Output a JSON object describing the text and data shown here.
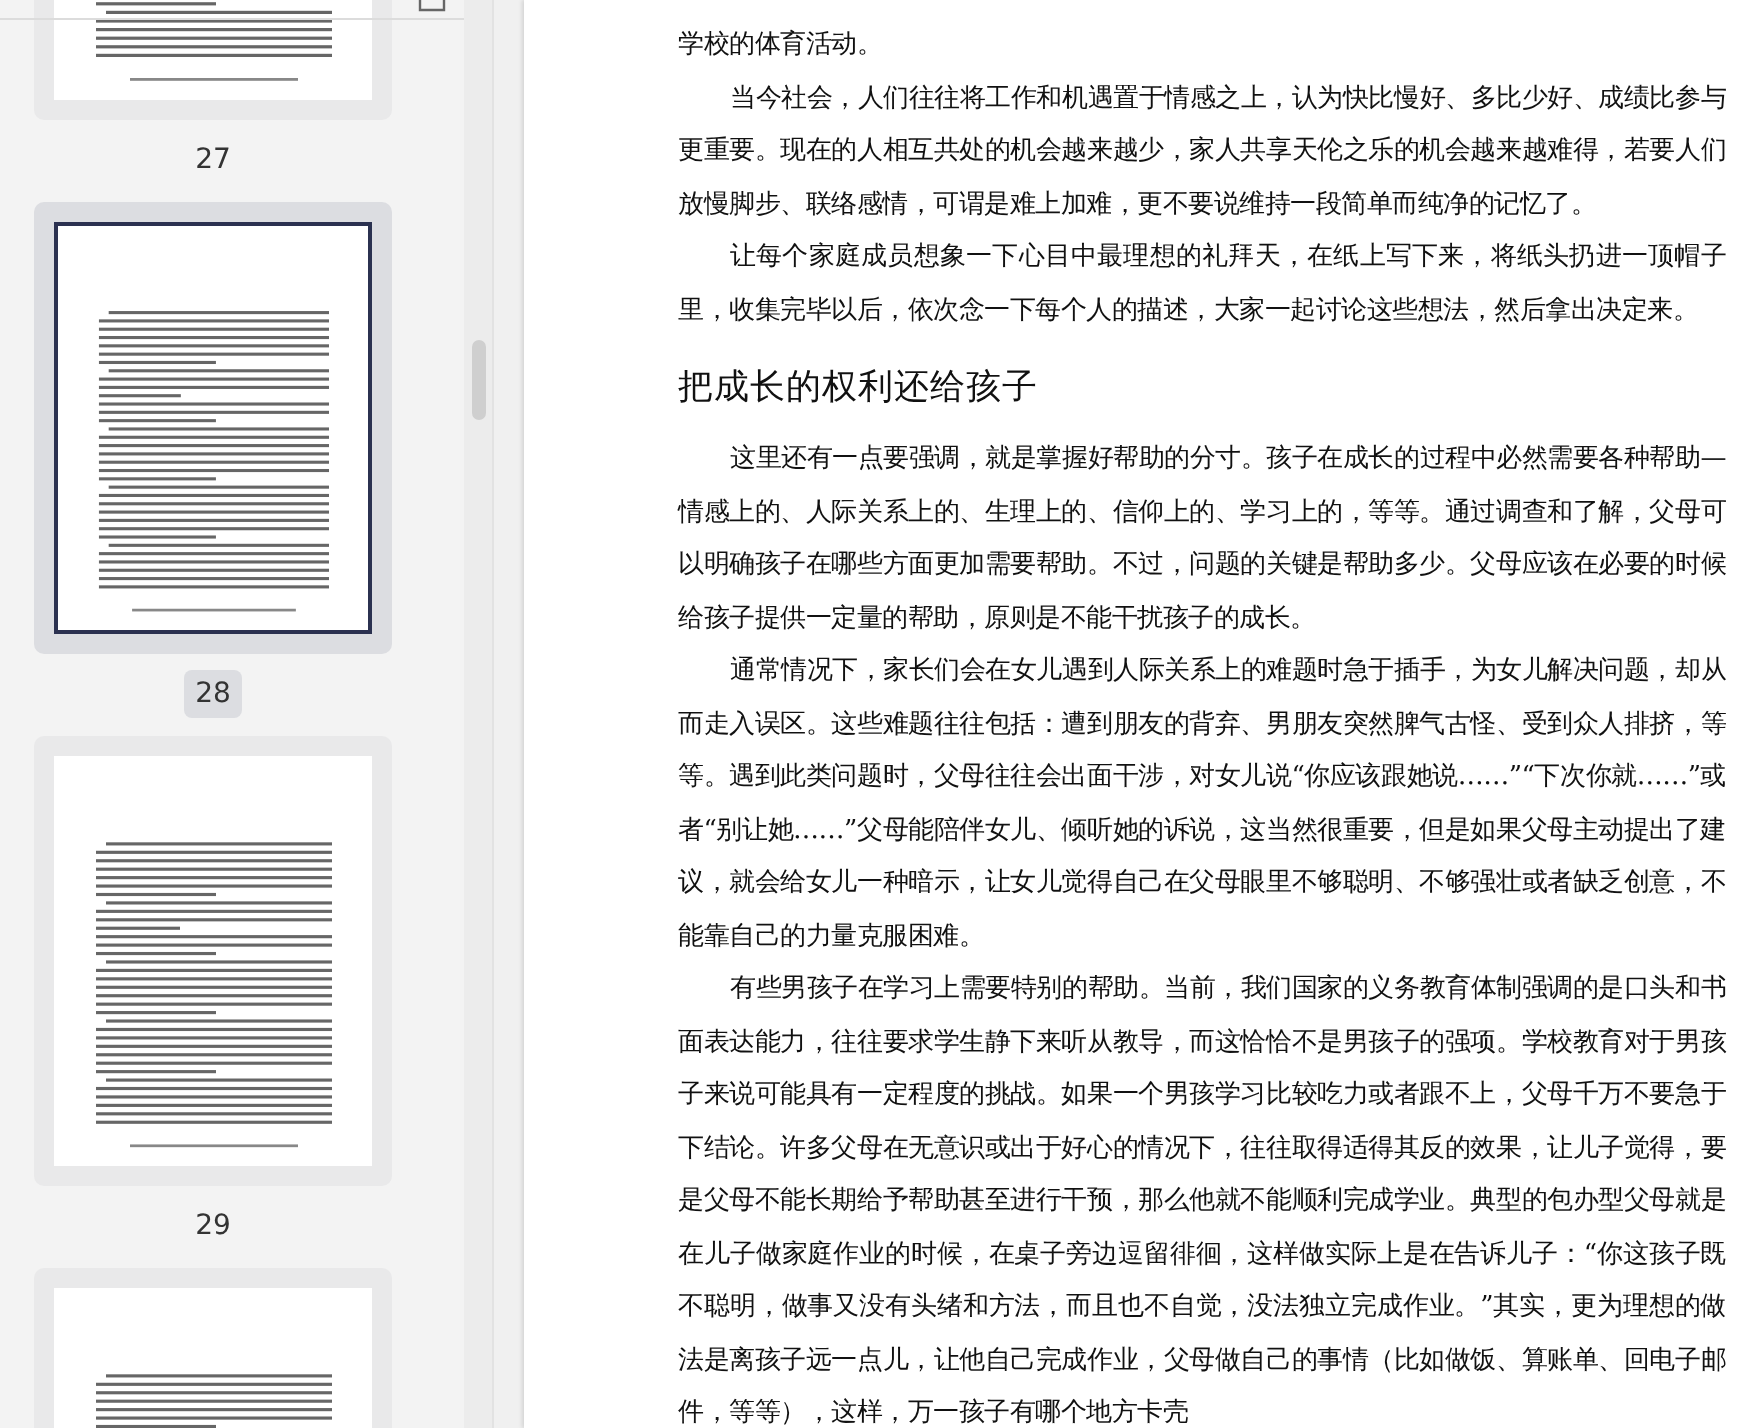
{
  "thumbnails": [
    {
      "page": "27",
      "selected": false
    },
    {
      "page": "28",
      "selected": true
    },
    {
      "page": "29",
      "selected": false
    },
    {
      "selected": false
    }
  ],
  "document": {
    "blocks": [
      {
        "kind": "continuation",
        "text": "学校的体育活动。"
      },
      {
        "kind": "paragraph",
        "text": "当今社会，人们往往将工作和机遇置于情感之上，认为快比慢好、多比少好、成绩比参与更重要。现在的人相互共处的机会越来越少，家人共享天伦之乐的机会越来越难得，若要人们放慢脚步、联络感情，可谓是难上加难，更不要说维持一段简单而纯净的记忆了。"
      },
      {
        "kind": "paragraph",
        "text": "让每个家庭成员想象一下心目中最理想的礼拜天，在纸上写下来，将纸头扔进一顶帽子里，收集完毕以后，依次念一下每个人的描述，大家一起讨论这些想法，然后拿出决定来。"
      },
      {
        "kind": "heading",
        "text": "把成长的权利还给孩子"
      },
      {
        "kind": "paragraph",
        "text": "这里还有一点要强调，就是掌握好帮助的分寸。孩子在成长的过程中必然需要各种帮助—　情感上的、人际关系上的、生理上的、信仰上的、学习上的，等等。通过调查和了解，父母可以明确孩子在哪些方面更加需要帮助。不过，问题的关键是帮助多少。父母应该在必要的时候给孩子提供一定量的帮助，原则是不能干扰孩子的成长。"
      },
      {
        "kind": "paragraph",
        "text": "通常情况下，家长们会在女儿遇到人际关系上的难题时急于插手，为女儿解决问题，却从而走入误区。这些难题往往包括：遭到朋友的背弃、男朋友突然脾气古怪、受到众人排挤，等等。遇到此类问题时，父母往往会出面干涉，对女儿说“你应该跟她说……”“下次你就……”或者“别让她……”父母能陪伴女儿、倾听她的诉说，这当然很重要，但是如果父母主动提出了建议，就会给女儿一种暗示，让女儿觉得自己在父母眼里不够聪明、不够强壮或者缺乏创意，不能靠自己的力量克服困难。"
      },
      {
        "kind": "paragraph",
        "text": "有些男孩子在学习上需要特别的帮助。当前，我们国家的义务教育体制强调的是口头和书面表达能力，往往要求学生静下来听从教导，而这恰恰不是男孩子的强项。学校教育对于男孩子来说可能具有一定程度的挑战。如果一个男孩学习比较吃力或者跟不上，父母千万不要急于下结论。许多父母在无意识或出于好心的情况下，往往取得适得其反的效果，让儿子觉得，要是父母不能长期给予帮助甚至进行干预，那么他就不能顺利完成学业。典型的包办型父母就是在儿子做家庭作业的时候，在桌子旁边逗留徘徊，这样做实际上是在告诉儿子：“你这孩子既不聪明，做事又没有头绪和方法，而且也不自觉，没法独立完成作业。”其实，更为理想的做法是离孩子远一点儿，让他自己完成作业，父母做自己的事情（比如做饭、算账单、回电子邮件，等等），这样，万一孩子有哪个地方卡壳"
      }
    ]
  }
}
